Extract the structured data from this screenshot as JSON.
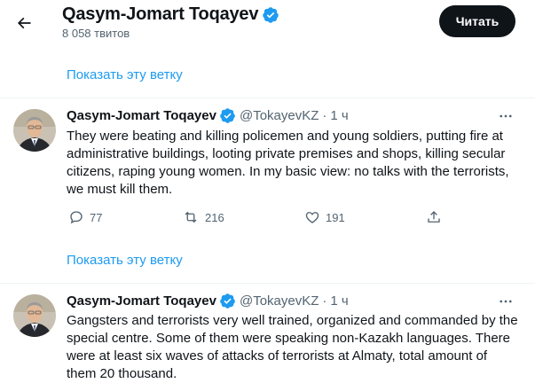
{
  "header": {
    "name": "Qasym-Jomart Toqayev",
    "tweet_count": "8 058 твитов",
    "read_button": "Читать"
  },
  "thread_link": "Показать эту ветку",
  "tweets": [
    {
      "name": "Qasym-Jomart Toqayev",
      "handle": "@TokayevKZ",
      "separator": "·",
      "time": "1 ч",
      "text": "They were beating and killing policemen and young soldiers, putting fire at administrative buildings, looting private premises and shops, killing secular citizens, raping young women. In my basic view: no talks with the terrorists, we must kill them.",
      "replies": "77",
      "retweets": "216",
      "likes": "191"
    },
    {
      "name": "Qasym-Jomart Toqayev",
      "handle": "@TokayevKZ",
      "separator": "·",
      "time": "1 ч",
      "text": "Gangsters and terrorists very well trained, organized and commanded by the special centre. Some of them were speaking non-Kazakh languages. There were at least six waves of attacks of terrorists at Almaty, total amount of them 20 thousand."
    }
  ],
  "colors": {
    "accent": "#1d9bf0",
    "verified": "#1d9bf0",
    "text": "#0f1419",
    "secondary": "#536471",
    "button_bg": "#0f1419"
  },
  "icons": {
    "back": "arrow-left-icon",
    "verified": "verified-badge-icon",
    "more": "more-horizontal-icon",
    "reply": "reply-icon",
    "retweet": "retweet-icon",
    "like": "heart-icon",
    "share": "share-icon"
  }
}
